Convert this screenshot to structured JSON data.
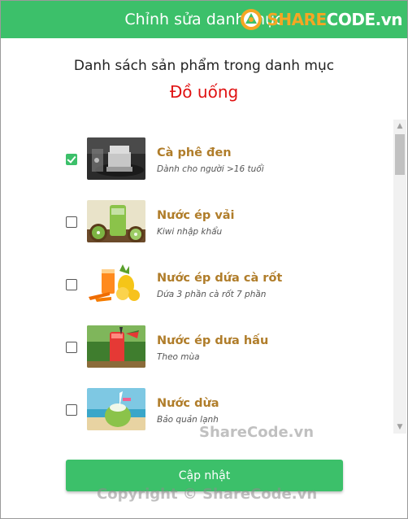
{
  "dialog": {
    "title": "Chỉnh sửa danh mục",
    "logo_text_1": "SHARE",
    "logo_text_2": "CODE.vn"
  },
  "heading": "Danh sách sản phẩm trong danh mục",
  "category_name": "Đồ uống",
  "products": [
    {
      "name": "Cà phê đen",
      "description": "Dành cho người >16 tuổi",
      "checked": true,
      "thumb": "coffee-image"
    },
    {
      "name": "Nước ép vải",
      "description": "Kiwi nhập khẩu",
      "checked": false,
      "thumb": "kiwi-juice-image"
    },
    {
      "name": "Nước ép dứa cà rốt",
      "description": "Dứa 3 phần cà rốt 7 phần",
      "checked": false,
      "thumb": "pineapple-carrot-image"
    },
    {
      "name": "Nước ép dưa hấu",
      "description": "Theo mùa",
      "checked": false,
      "thumb": "watermelon-juice-image"
    },
    {
      "name": "Nước dừa",
      "description": "Bảo quản lạnh",
      "checked": false,
      "thumb": "coconut-image"
    }
  ],
  "update_button": "Cập nhật",
  "watermark_1": "ShareCode.vn",
  "watermark_2": "Copyright © ShareCode.vn",
  "colors": {
    "header": "#3cc06a",
    "category": "#e01212",
    "product_name": "#b07d2a",
    "button": "#3cc06a"
  }
}
